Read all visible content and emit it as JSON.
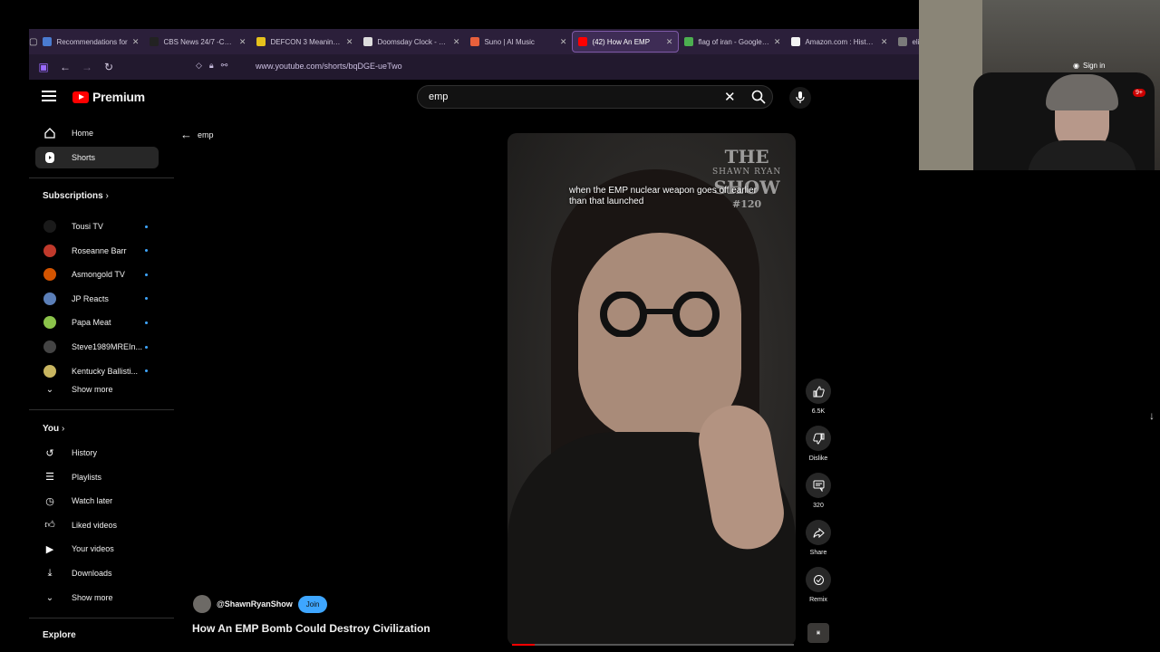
{
  "browser": {
    "tabs": [
      {
        "title": "Recommendations for",
        "color": "#4a7bd0",
        "active": false
      },
      {
        "title": "CBS News 24/7 -CBS N",
        "color": "#222222",
        "active": false
      },
      {
        "title": "DEFCON 3 Meaning | R",
        "color": "#e6c21c",
        "active": false
      },
      {
        "title": "Doomsday Clock - Bull",
        "color": "#dddddd",
        "active": false
      },
      {
        "title": "Suno | AI Music",
        "color": "#e8603c",
        "active": false
      },
      {
        "title": "(42) How An EMP",
        "color": "#ff0000",
        "active": true
      },
      {
        "title": "flag of iran - Google Se",
        "color": "#4caf50",
        "active": false
      },
      {
        "title": "Amazon.com : Historic",
        "color": "#f3f3f3",
        "active": false
      },
      {
        "title": "eligion of iran",
        "color": "#7a7a7a",
        "active": false
      }
    ],
    "url": "www.youtube.com/shorts/bqDGE-ueTwo",
    "sign_in": "Sign in",
    "notif_count": "9+"
  },
  "yt": {
    "logo_text": "Premium",
    "search": {
      "value": "emp"
    },
    "back_label": "emp",
    "sidebar": {
      "main": [
        {
          "label": "Home",
          "icon": "home-icon"
        },
        {
          "label": "Shorts",
          "icon": "shorts-icon",
          "active": true
        }
      ],
      "subscriptions_title": "Subscriptions",
      "subscriptions": [
        {
          "label": "Tousi TV",
          "color": "#1a1a1a"
        },
        {
          "label": "Roseanne Barr",
          "color": "#c0392b"
        },
        {
          "label": "Asmongold TV",
          "color": "#d35400"
        },
        {
          "label": "JP Reacts",
          "color": "#5b7fb8"
        },
        {
          "label": "Papa Meat",
          "color": "#8bc34a"
        },
        {
          "label": "Steve1989MREIn...",
          "color": "#444444"
        },
        {
          "label": "Kentucky Ballisti...",
          "color": "#c8b560"
        }
      ],
      "show_more": "Show more",
      "you_title": "You",
      "you": [
        {
          "label": "History",
          "icon": "history-icon"
        },
        {
          "label": "Playlists",
          "icon": "playlists-icon"
        },
        {
          "label": "Watch later",
          "icon": "watch-later-icon"
        },
        {
          "label": "Liked videos",
          "icon": "liked-videos-icon"
        },
        {
          "label": "Your videos",
          "icon": "your-videos-icon"
        },
        {
          "label": "Downloads",
          "icon": "downloads-icon"
        }
      ],
      "show_more_2": "Show more",
      "explore_title": "Explore"
    },
    "video": {
      "caption": "when the EMP nuclear weapon goes off earlier than that launched",
      "brand_line1": "THE",
      "brand_line2": "SHAWN RYAN",
      "brand_line3": "SHOW",
      "brand_line4": "#120",
      "progress_pct": 8
    },
    "actions": {
      "like_count": "6.5K",
      "dislike_label": "Dislike",
      "comment_count": "320",
      "share_label": "Share",
      "remix_label": "Remix"
    },
    "channel": {
      "handle": "@ShawnRyanShow",
      "join": "Join"
    },
    "title": "How An EMP Bomb Could Destroy Civilization"
  }
}
